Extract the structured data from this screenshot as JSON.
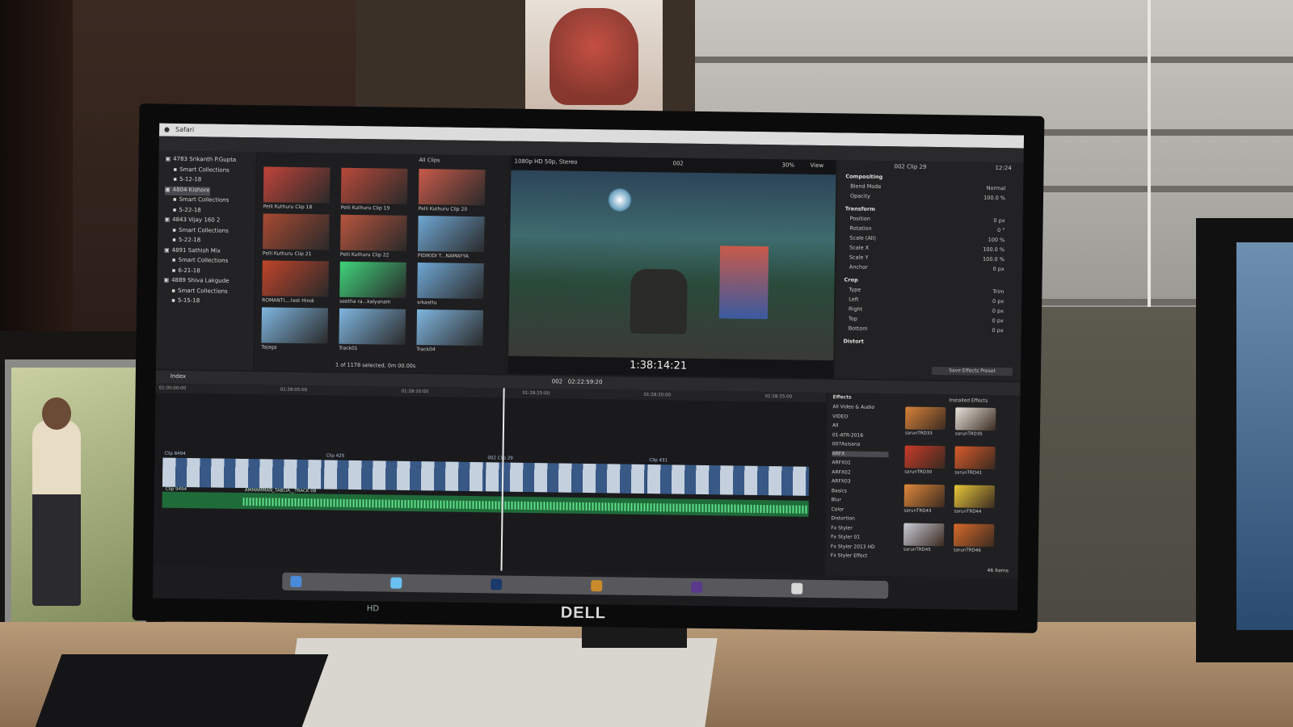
{
  "scene": {
    "description_items": [
      "photo-frame",
      "monitor",
      "cabinet",
      "desk"
    ],
    "brand_logo": "DELL",
    "bezel_badge": "HD"
  },
  "app": {
    "menu": [
      "Safari"
    ],
    "library": {
      "items": [
        {
          "label": "4783 Srikanth P.Gupta",
          "level": 0
        },
        {
          "label": "Smart Collections",
          "level": 1
        },
        {
          "label": "5-12-18",
          "level": 1
        },
        {
          "label": "4804 Kishore",
          "level": 0,
          "selected": true
        },
        {
          "label": "Smart Collections",
          "level": 1
        },
        {
          "label": "5-22-18",
          "level": 1
        },
        {
          "label": "4843 Vijay 160 2",
          "level": 0
        },
        {
          "label": "Smart Collections",
          "level": 1
        },
        {
          "label": "5-22-18",
          "level": 1
        },
        {
          "label": "4891 Sathish Mix",
          "level": 0
        },
        {
          "label": "Smart Collections",
          "level": 1
        },
        {
          "label": "6-21-18",
          "level": 1
        },
        {
          "label": "4889 Shiva Lakgude",
          "level": 0
        },
        {
          "label": "Smart Collections",
          "level": 1
        },
        {
          "label": "5-15-18",
          "level": 1
        }
      ]
    },
    "browser": {
      "filter": "All Clips",
      "status": "1 of 1178 selected, 0m 00.00s",
      "clips": [
        {
          "label": "Pelli Kuthuru Clip 18",
          "color": "#c0443a"
        },
        {
          "label": "Pelli Kuthuru Clip 19",
          "color": "#b84a3a"
        },
        {
          "label": "Pelli Kuthuru Clip 20",
          "color": "#c85a4a"
        },
        {
          "label": "Pelli Kuthuru Clip 21",
          "color": "#a84a32"
        },
        {
          "label": "Pelli Kuthuru Clip 22",
          "color": "#b8553e"
        },
        {
          "label": "PIDIKIDI T...NAMAYYA",
          "color": "#6fa7d4"
        },
        {
          "label": "ROMANTI....test Hindi",
          "color": "#c0442a"
        },
        {
          "label": "seetha ra...kalyanam",
          "color": "#3fd47a"
        },
        {
          "label": "srkasttu",
          "color": "#6fa7d4"
        },
        {
          "label": "Tajaga",
          "color": "#7fb6e0"
        },
        {
          "label": "Track01",
          "color": "#7fb6e0"
        },
        {
          "label": "Track04",
          "color": "#7fb6e0"
        }
      ]
    },
    "viewer": {
      "format": "1080p HD 50p, Stereo",
      "clip": "002",
      "zoom": "30%",
      "view": "View",
      "timecode": "1:38:14:21"
    },
    "inspector": {
      "clip_name": "002 Clip 29",
      "duration": "12:24",
      "sections": [
        {
          "head": "Compositing",
          "rows": [
            {
              "label": "Blend Mode",
              "value": "Normal"
            },
            {
              "label": "Opacity",
              "value": "100.0 %"
            }
          ]
        },
        {
          "head": "Transform",
          "rows": [
            {
              "label": "Position",
              "value": "0 px"
            },
            {
              "label": "Rotation",
              "value": "0 °"
            },
            {
              "label": "Scale (All)",
              "value": "100 %"
            },
            {
              "label": "Scale X",
              "value": "100.0 %"
            },
            {
              "label": "Scale Y",
              "value": "100.0 %"
            },
            {
              "label": "Anchor",
              "value": "0 px"
            }
          ]
        },
        {
          "head": "Crop",
          "rows": [
            {
              "label": "Type",
              "value": "Trim"
            },
            {
              "label": "Left",
              "value": "0 px"
            },
            {
              "label": "Right",
              "value": "0 px"
            },
            {
              "label": "Top",
              "value": "0 px"
            },
            {
              "label": "Bottom",
              "value": "0 px"
            }
          ]
        },
        {
          "head": "Distort",
          "rows": []
        }
      ],
      "save_button": "Save Effects Preset"
    },
    "timeline": {
      "index_label": "Index",
      "project": "002",
      "duration": "02:22:59:20",
      "ruler": [
        "01:00:00:00",
        "01:28:05:00",
        "01:28:10:00",
        "01:28:15:00",
        "01:28:20:00",
        "01:28:25:00"
      ],
      "video_clips": [
        "Clip 8494",
        "Clip 425",
        "002 Clip 29",
        "Clip 431"
      ],
      "audio_clip": "AMMAMMAN_TABLIA__TRACK 08",
      "audio_clip_left": "Clip 9494"
    },
    "effects": {
      "header": "Effects",
      "installed": "Installed Effects",
      "categories": [
        "All Video & Audio",
        "VIDEO",
        "All",
        "01-ATR-2016",
        "007Asisana",
        "ARFX",
        "ARFX01",
        "ARFX02",
        "ARFX03",
        "Basics",
        "Blur",
        "Color",
        "Distortion",
        "Fx Styler",
        "Fx Styler 01",
        "Fx Styler 2013 HD",
        "Fx Styler Effect"
      ],
      "selected_category": "ARFX",
      "items": [
        {
          "name": "sarunTRD33",
          "color": "#d9833a"
        },
        {
          "name": "sarunTRD35",
          "color": "#e8e4dc"
        },
        {
          "name": "sarunTRD39",
          "color": "#c83a2a"
        },
        {
          "name": "sarunTRD41",
          "color": "#d85a2a"
        },
        {
          "name": "sarunTRD43",
          "color": "#e0883a"
        },
        {
          "name": "sarunTRD44",
          "color": "#e8c83a"
        },
        {
          "name": "sarunTRD45",
          "color": "#c8ccd8"
        },
        {
          "name": "sarunTRD46",
          "color": "#d86a2a"
        }
      ],
      "count": "46 Items"
    },
    "dock_icons": [
      "finder-icon",
      "safari-icon",
      "photoshop-icon",
      "bridge-icon",
      "after-effects-icon",
      "trash-icon"
    ]
  }
}
